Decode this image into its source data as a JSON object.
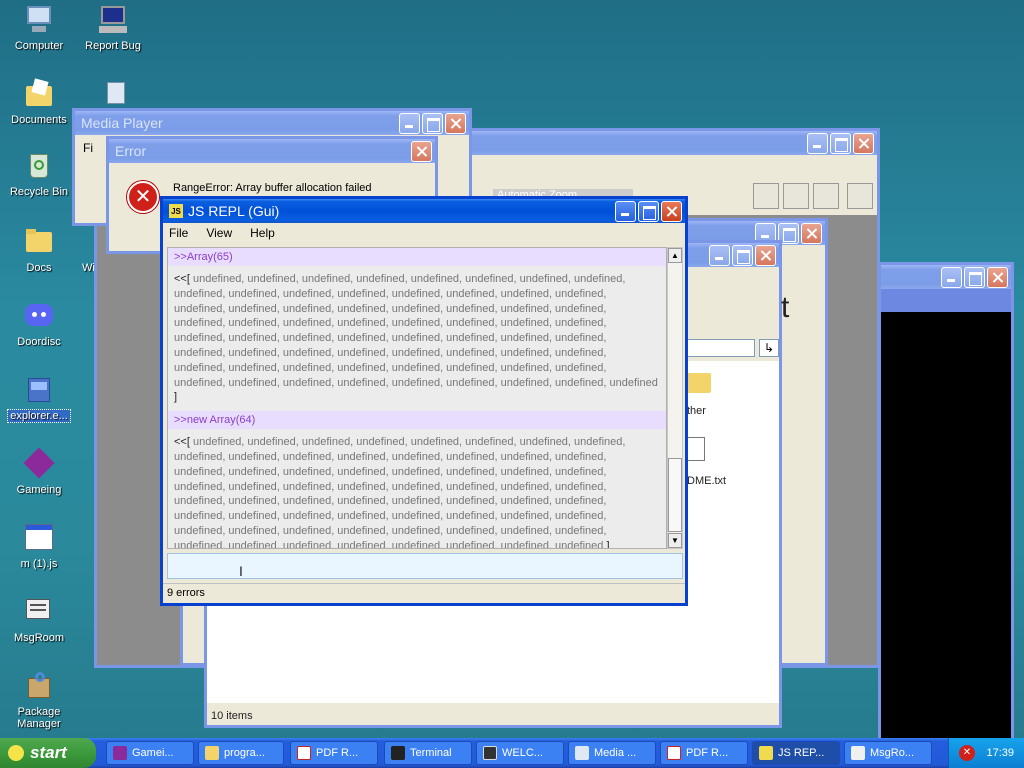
{
  "desktop_icons": [
    {
      "label": "Computer"
    },
    {
      "label": "Report Bug"
    },
    {
      "label": "Documents"
    },
    {
      "label": "Recycle Bin"
    },
    {
      "label": "Docs"
    },
    {
      "label": "Doordisc"
    },
    {
      "label": "explorer.e..."
    },
    {
      "label": "Gameing"
    },
    {
      "label": "m (1).js"
    },
    {
      "label": "MsgRoom"
    },
    {
      "label": "Package Manager"
    },
    {
      "label": "Wi"
    }
  ],
  "media_player": {
    "title": "Media Player",
    "menu_fragment": "Fi"
  },
  "error_dialog": {
    "title": "Error",
    "message": "RangeError: Array buffer allocation failed"
  },
  "bg_window": {
    "zoom_label": "Automatic Zoom"
  },
  "explorer": {
    "status": "10 items",
    "items": [
      {
        "label": "ther"
      },
      {
        "label": "DME.txt"
      }
    ],
    "big_letter": "t"
  },
  "repl": {
    "title": "JS REPL (Gui)",
    "menu": [
      "File",
      "View",
      "Help"
    ],
    "entries": [
      {
        "cmd": ">>Array(65)",
        "prefix": "<<",
        "open": "[",
        "body": "undefined, undefined, undefined, undefined, undefined, undefined, undefined, undefined, undefined, undefined, undefined, undefined, undefined, undefined, undefined, undefined, undefined, undefined, undefined, undefined, undefined, undefined, undefined, undefined, undefined, undefined, undefined, undefined, undefined, undefined, undefined, undefined, undefined, undefined, undefined, undefined, undefined, undefined, undefined, undefined, undefined, undefined, undefined, undefined, undefined, undefined, undefined, undefined, undefined, undefined, undefined, undefined, undefined, undefined, undefined, undefined, undefined, undefined, undefined, undefined, undefined, undefined, undefined, undefined, undefined",
        "close": "]"
      },
      {
        "cmd": ">>new Array(64)",
        "prefix": "<<",
        "open": "[",
        "body": "undefined, undefined, undefined, undefined, undefined, undefined, undefined, undefined, undefined, undefined, undefined, undefined, undefined, undefined, undefined, undefined, undefined, undefined, undefined, undefined, undefined, undefined, undefined, undefined, undefined, undefined, undefined, undefined, undefined, undefined, undefined, undefined, undefined, undefined, undefined, undefined, undefined, undefined, undefined, undefined, undefined, undefined, undefined, undefined, undefined, undefined, undefined, undefined, undefined, undefined, undefined, undefined, undefined, undefined, undefined, undefined, undefined, undefined, undefined, undefined, undefined, undefined, undefined, undefined",
        "close": "]"
      }
    ],
    "input_value": "",
    "status": "9 errors"
  },
  "taskbar": {
    "start_label": "start",
    "tasks": [
      {
        "label": "Gamei..."
      },
      {
        "label": "progra..."
      },
      {
        "label": "PDF R..."
      },
      {
        "label": "Terminal"
      },
      {
        "label": "WELC..."
      },
      {
        "label": "Media ..."
      },
      {
        "label": "PDF R..."
      },
      {
        "label": "JS REP..."
      },
      {
        "label": "MsgRo..."
      }
    ],
    "clock": "17:39"
  },
  "colors": {
    "accent": "#0a5fe0",
    "start_green": "#3c9a3c",
    "repl_cmd_bg": "#e8dcff",
    "repl_cmd_fg": "#8a3fc8"
  }
}
